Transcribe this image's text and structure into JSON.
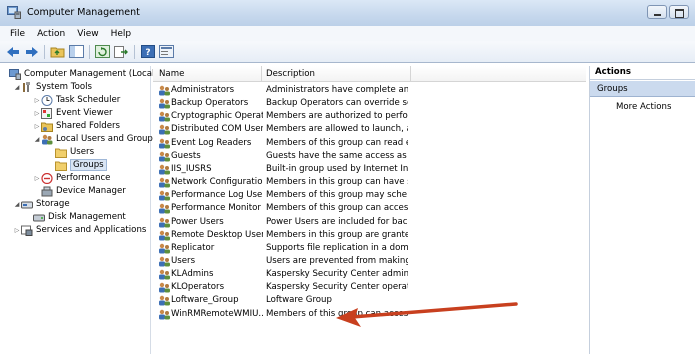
{
  "window": {
    "title": "Computer Management"
  },
  "menu": [
    "File",
    "Action",
    "View",
    "Help"
  ],
  "toolbar": {
    "buttons": [
      "back-icon",
      "forward-icon",
      "up-folder-icon",
      "show-hide-tree-icon",
      "refresh-icon",
      "export-list-icon",
      "help-icon",
      "properties-icon"
    ]
  },
  "tree": {
    "root": "Computer Management (Local",
    "system_tools": "System Tools",
    "task_scheduler": "Task Scheduler",
    "event_viewer": "Event Viewer",
    "shared_folders": "Shared Folders",
    "local_users": "Local Users and Groups",
    "users": "Users",
    "groups": "Groups",
    "performance": "Performance",
    "device_manager": "Device Manager",
    "storage": "Storage",
    "disk_management": "Disk Management",
    "services": "Services and Applications"
  },
  "list": {
    "columns": [
      "Name",
      "Description"
    ],
    "rows": [
      {
        "name": "Administrators",
        "description": "Administrators have complete an..."
      },
      {
        "name": "Backup Operators",
        "description": "Backup Operators can override se..."
      },
      {
        "name": "Cryptographic Operat...",
        "description": "Members are authorized to perfor..."
      },
      {
        "name": "Distributed COM Users",
        "description": "Members are allowed to launch, a..."
      },
      {
        "name": "Event Log Readers",
        "description": "Members of this group can read e..."
      },
      {
        "name": "Guests",
        "description": "Guests have the same access as m..."
      },
      {
        "name": "IIS_IUSRS",
        "description": "Built-in group used by Internet Inf..."
      },
      {
        "name": "Network Configuratio...",
        "description": "Members in this group can have s..."
      },
      {
        "name": "Performance Log Users",
        "description": "Members of this group may sche..."
      },
      {
        "name": "Performance Monitor ...",
        "description": "Members of this group can acces..."
      },
      {
        "name": "Power Users",
        "description": "Power Users are included for back..."
      },
      {
        "name": "Remote Desktop Users",
        "description": "Members in this group are grante..."
      },
      {
        "name": "Replicator",
        "description": "Supports file replication in a dom..."
      },
      {
        "name": "Users",
        "description": "Users are prevented from making ..."
      },
      {
        "name": "KLAdmins",
        "description": "Kaspersky Security Center admini..."
      },
      {
        "name": "KLOperators",
        "description": "Kaspersky Security Center operators"
      },
      {
        "name": "Loftware_Group",
        "description": "Loftware Group"
      },
      {
        "name": "WinRMRemoteWMIU...",
        "description": "Members of this group can acces..."
      }
    ]
  },
  "actions": {
    "header": "Actions",
    "group": "Groups",
    "more": "More Actions"
  },
  "colors": {
    "selection": "#d9e5f4",
    "actions_group_bg": "#cbdaee",
    "annotation_arrow": "#c8401f"
  }
}
